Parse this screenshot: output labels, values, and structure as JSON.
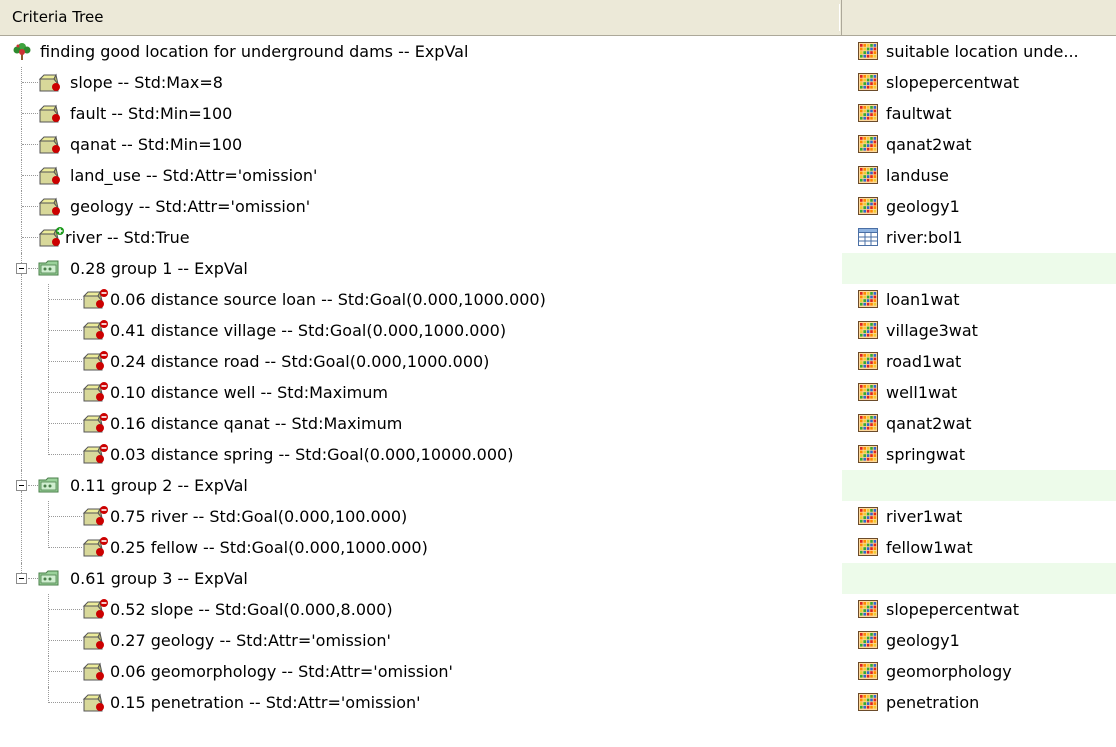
{
  "header": {
    "col1": "Criteria Tree",
    "col2": ""
  },
  "root": {
    "label": "finding good location for underground dams -- ExpVal",
    "layer": "suitable location unde..."
  },
  "constraints": [
    {
      "label": "slope -- Std:Max=8",
      "layer": "slopepercentwat",
      "sign": "minus"
    },
    {
      "label": "fault -- Std:Min=100",
      "layer": "faultwat",
      "sign": "minus"
    },
    {
      "label": "qanat -- Std:Min=100",
      "layer": "qanat2wat",
      "sign": "minus"
    },
    {
      "label": "land_use -- Std:Attr='omission'",
      "layer": "landuse",
      "sign": "minus"
    },
    {
      "label": "geology -- Std:Attr='omission'",
      "layer": "geology1",
      "sign": "minus"
    },
    {
      "label": "river -- Std:True",
      "layer": "river:bol1",
      "sign": "plus"
    }
  ],
  "groups": [
    {
      "label": "0.28 group 1 -- ExpVal",
      "children": [
        {
          "label": "0.06 distance source loan -- Std:Goal(0.000,1000.000)",
          "layer": "loan1wat",
          "sign": "red"
        },
        {
          "label": "0.41 distance village -- Std:Goal(0.000,1000.000)",
          "layer": "village3wat",
          "sign": "red"
        },
        {
          "label": "0.24 distance road -- Std:Goal(0.000,1000.000)",
          "layer": "road1wat",
          "sign": "red"
        },
        {
          "label": "0.10 distance well -- Std:Maximum",
          "layer": "well1wat",
          "sign": "red"
        },
        {
          "label": "0.16 distance qanat -- Std:Maximum",
          "layer": "qanat2wat",
          "sign": "red"
        },
        {
          "label": "0.03 distance spring -- Std:Goal(0.000,10000.000)",
          "layer": "springwat",
          "sign": "red"
        }
      ]
    },
    {
      "label": "0.11 group 2 -- ExpVal",
      "children": [
        {
          "label": "0.75 river -- Std:Goal(0.000,100.000)",
          "layer": "river1wat",
          "sign": "red"
        },
        {
          "label": "0.25 fellow -- Std:Goal(0.000,1000.000)",
          "layer": "fellow1wat",
          "sign": "red"
        }
      ]
    },
    {
      "label": "0.61 group 3 -- ExpVal",
      "children": [
        {
          "label": "0.52 slope -- Std:Goal(0.000,8.000)",
          "layer": "slopepercentwat",
          "sign": "red"
        },
        {
          "label": "0.27 geology -- Std:Attr='omission'",
          "layer": "geology1",
          "sign": "none"
        },
        {
          "label": "0.06 geomorphology -- Std:Attr='omission'",
          "layer": "geomorphology",
          "sign": "none"
        },
        {
          "label": "0.15 penetration -- Std:Attr='omission'",
          "layer": "penetration",
          "sign": "none"
        }
      ]
    }
  ],
  "colors": {
    "header_bg": "#ece9d8",
    "group_row_bg": "#edfbea",
    "minus_sign": "#cc0000",
    "plus_sign": "#008000"
  }
}
